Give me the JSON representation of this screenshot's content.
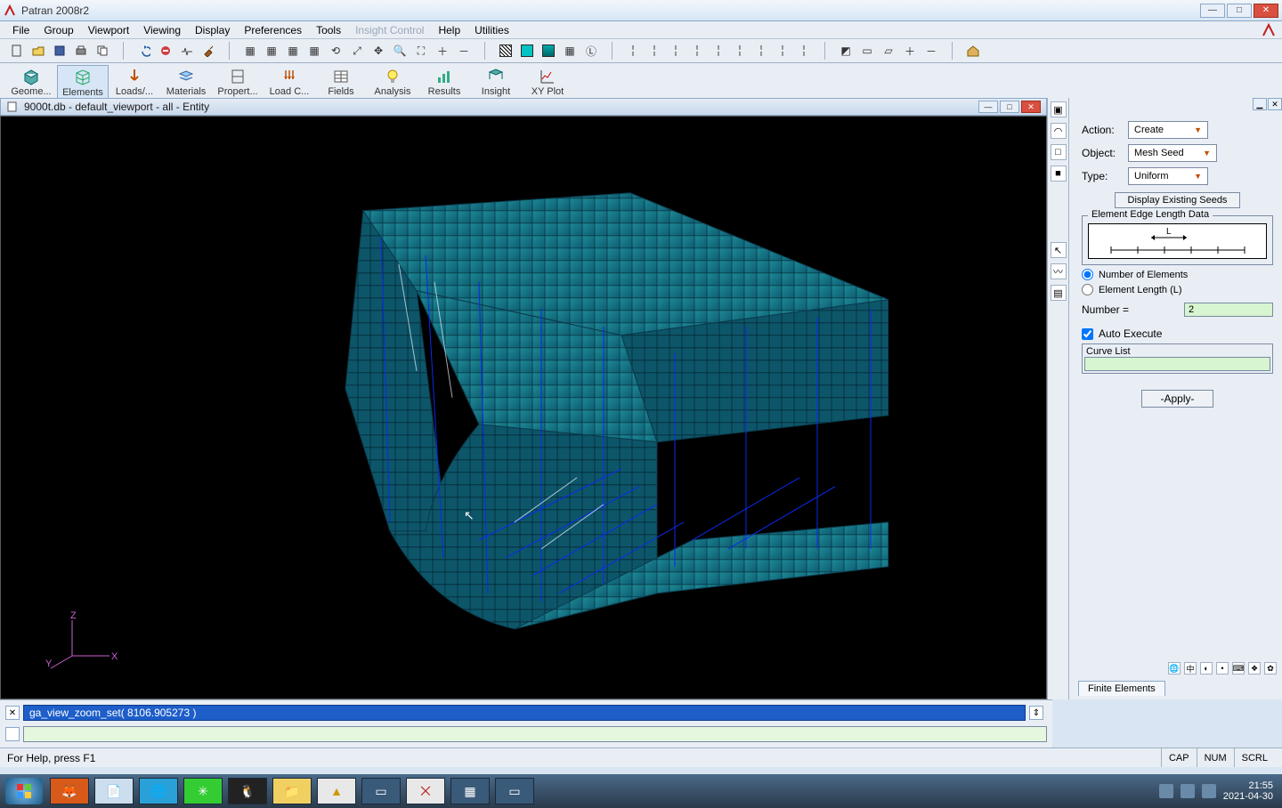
{
  "app": {
    "title": "Patran 2008r2"
  },
  "menus": [
    "File",
    "Group",
    "Viewport",
    "Viewing",
    "Display",
    "Preferences",
    "Tools",
    "Insight Control",
    "Help",
    "Utilities"
  ],
  "menus_dimmed": [
    "Insight Control"
  ],
  "app_tabs": [
    {
      "label": "Geome...",
      "icon": "cube"
    },
    {
      "label": "Elements",
      "icon": "grid"
    },
    {
      "label": "Loads/...",
      "icon": "arrow-down"
    },
    {
      "label": "Materials",
      "icon": "layers"
    },
    {
      "label": "Propert...",
      "icon": "section"
    },
    {
      "label": "Load C...",
      "icon": "arrows"
    },
    {
      "label": "Fields",
      "icon": "table"
    },
    {
      "label": "Analysis",
      "icon": "bulb"
    },
    {
      "label": "Results",
      "icon": "chart"
    },
    {
      "label": "Insight",
      "icon": "eye"
    },
    {
      "label": "XY Plot",
      "icon": "plot"
    }
  ],
  "viewport": {
    "title": "9000t.db - default_viewport - all - Entity",
    "triad": {
      "x": "X",
      "y": "Y",
      "z": "Z"
    }
  },
  "command_history": "ga_view_zoom_set( 8106.905273 )",
  "status": {
    "help": "For Help, press F1",
    "cap": "CAP",
    "num": "NUM",
    "scrl": "SCRL"
  },
  "panel": {
    "action_label": "Action:",
    "action_value": "Create",
    "object_label": "Object:",
    "object_value": "Mesh Seed",
    "type_label": "Type:",
    "type_value": "Uniform",
    "display_btn": "Display Existing Seeds",
    "edge_legend": "Element Edge Length Data",
    "diagram_label": "L",
    "radio1": "Number of Elements",
    "radio2": "Element Length (L)",
    "number_label": "Number =",
    "number_value": "2",
    "auto_exec": "Auto Execute",
    "curve_list": "Curve List",
    "apply": "-Apply-",
    "footer_tab": "Finite Elements"
  },
  "clock": {
    "time": "21:55",
    "date": "2021-04-30"
  },
  "taskbar_apps": [
    "firefox",
    "notepad",
    "globe",
    "wechat",
    "qq",
    "explorer",
    "ansys",
    "window",
    "patran",
    "grid",
    "window2"
  ]
}
